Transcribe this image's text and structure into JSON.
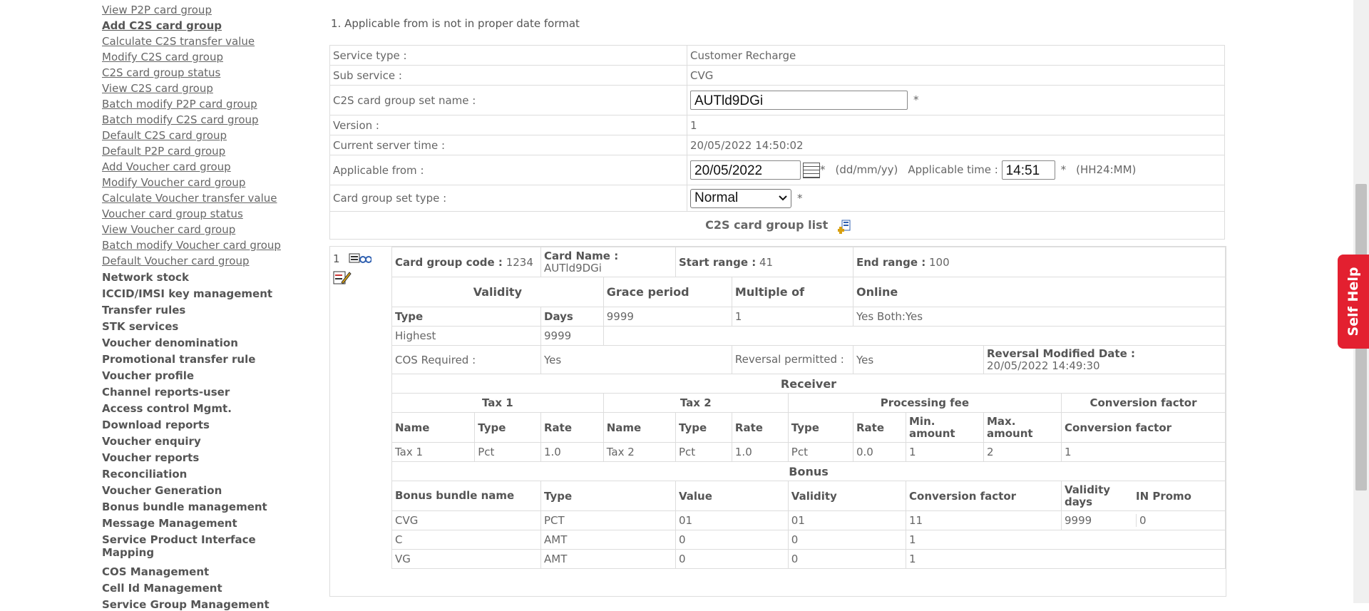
{
  "sidebar": {
    "links": [
      "View P2P card group",
      "Add C2S card group",
      "Calculate C2S transfer value",
      "Modify C2S card group",
      "C2S card group status",
      "View C2S card group",
      "Batch modify P2P card group",
      "Batch modify C2S card group",
      "Default C2S card group",
      "Default P2P card group",
      "Add Voucher card group",
      "Modify Voucher card group",
      "Calculate Voucher transfer value",
      "Voucher card group status",
      "View Voucher card group",
      "Batch modify Voucher card group",
      "Default Voucher card group"
    ],
    "active_link": "Add C2S card group",
    "sections": [
      "Network stock",
      "ICCID/IMSI key management",
      "Transfer rules",
      "STK services",
      "Voucher denomination",
      "Promotional transfer rule",
      "Voucher profile",
      "Channel reports-user",
      "Access control Mgmt.",
      "Download reports",
      "Voucher enquiry",
      "Voucher reports",
      "Reconciliation",
      "Voucher Generation",
      "Bonus bundle management",
      "Message Management",
      "Service Product Interface Mapping",
      "COS Management",
      "Cell Id Management",
      "Service Group Management"
    ]
  },
  "error_message": "1. Applicable from is not in proper date format",
  "form": {
    "service_type_label": "Service type :",
    "service_type_value": "Customer Recharge",
    "sub_service_label": "Sub service :",
    "sub_service_value": "CVG",
    "set_name_label": "C2S card group set name :",
    "set_name_value": "AUTld9DGi",
    "version_label": "Version :",
    "version_value": "1",
    "server_time_label": "Current server time :",
    "server_time_value": "20/05/2022 14:50:02",
    "applicable_from_label": "Applicable from :",
    "applicable_from_value": "20/05/2022",
    "date_format_hint": "(dd/mm/yy)",
    "applicable_time_label": "Applicable time :",
    "applicable_time_value": "14:51",
    "time_format_hint": "(HH24:MM)",
    "set_type_label": "Card group set type :",
    "set_type_value": "Normal",
    "required_mark": "*"
  },
  "card_group_list_title": "C2S card group list",
  "card_group": {
    "index": "1",
    "code_label": "Card group code :",
    "code_value": "1234",
    "card_name_label": "Card Name :",
    "card_name_value": "AUTld9DGi",
    "start_range_label": "Start range :",
    "start_range_value": "41",
    "end_range_label": "End range :",
    "end_range_value": "100",
    "validity_header": "Validity",
    "grace_header": "Grace period",
    "multiple_header": "Multiple of",
    "online_header": "Online",
    "type_header": "Type",
    "days_header": "Days",
    "grace_value": "9999",
    "multiple_value": "1",
    "online_value": "Yes Both:Yes",
    "validity_type": "Highest",
    "validity_days": "9999",
    "cos_label": "COS Required :",
    "cos_value": "Yes",
    "reversal_label": "Reversal permitted :",
    "reversal_value": "Yes",
    "reversal_date_label": "Reversal Modified Date :",
    "reversal_date_value": "20/05/2022 14:49:30",
    "receiver_header": "Receiver",
    "tax1_header": "Tax 1",
    "tax2_header": "Tax 2",
    "processing_fee_header": "Processing fee",
    "conversion_factor_header": "Conversion factor",
    "name_col": "Name",
    "type_col": "Type",
    "rate_col": "Rate",
    "min_amount_col": "Min. amount",
    "max_amount_col": "Max. amount",
    "receiver_row": [
      "Tax 1",
      "Pct",
      "1.0",
      "Tax 2",
      "Pct",
      "1.0",
      "Pct",
      "0.0",
      "1",
      "2",
      "1"
    ],
    "bonus_header": "Bonus",
    "bonus_columns": [
      "Bonus bundle name",
      "Type",
      "Value",
      "Validity",
      "Conversion factor",
      "Validity days",
      "IN Promo"
    ],
    "bonus_rows": [
      [
        "CVG",
        "PCT",
        "01",
        "01",
        "11",
        "9999",
        "0"
      ],
      [
        "C",
        "AMT",
        "0",
        "0",
        "1",
        "",
        ""
      ],
      [
        "VG",
        "AMT",
        "0",
        "0",
        "1",
        "",
        ""
      ]
    ]
  },
  "self_help_label": "Self Help",
  "colors": {
    "self_help": "#e32030",
    "link": "#666666"
  }
}
